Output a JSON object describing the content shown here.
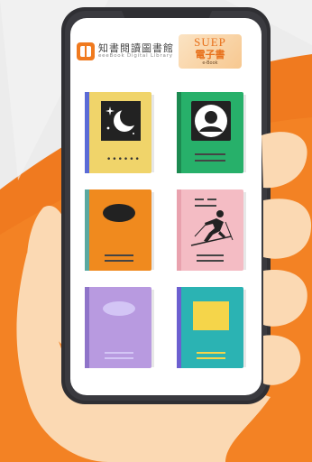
{
  "header": {
    "brand_title": "知書閱讀圖書館",
    "brand_subtitle": "eeeBook Digital Library",
    "ebook_badge_title": "SUEP",
    "ebook_badge_subtitle": "電子書",
    "ebook_badge_caption": "e-Book"
  },
  "colors": {
    "background": "#ececec",
    "accent_orange": "#f07a1f",
    "phone_body": "#2f2f33",
    "skin": "#fbd9b3",
    "book_yellow": "#f0d46a",
    "book_green": "#27b06a",
    "book_orange": "#f08a1e",
    "book_pink": "#f4bcc4",
    "book_purple": "#b89ae0",
    "book_teal": "#2bb3b3"
  },
  "books": [
    {
      "name": "book-moon",
      "icon": "moon-icon"
    },
    {
      "name": "book-profile",
      "icon": "user-icon"
    },
    {
      "name": "book-oval",
      "icon": "oval-shape"
    },
    {
      "name": "book-skier",
      "icon": "skier-icon"
    },
    {
      "name": "book-purple",
      "icon": "oval-shape"
    },
    {
      "name": "book-teal",
      "icon": "rectangle-shape"
    }
  ]
}
